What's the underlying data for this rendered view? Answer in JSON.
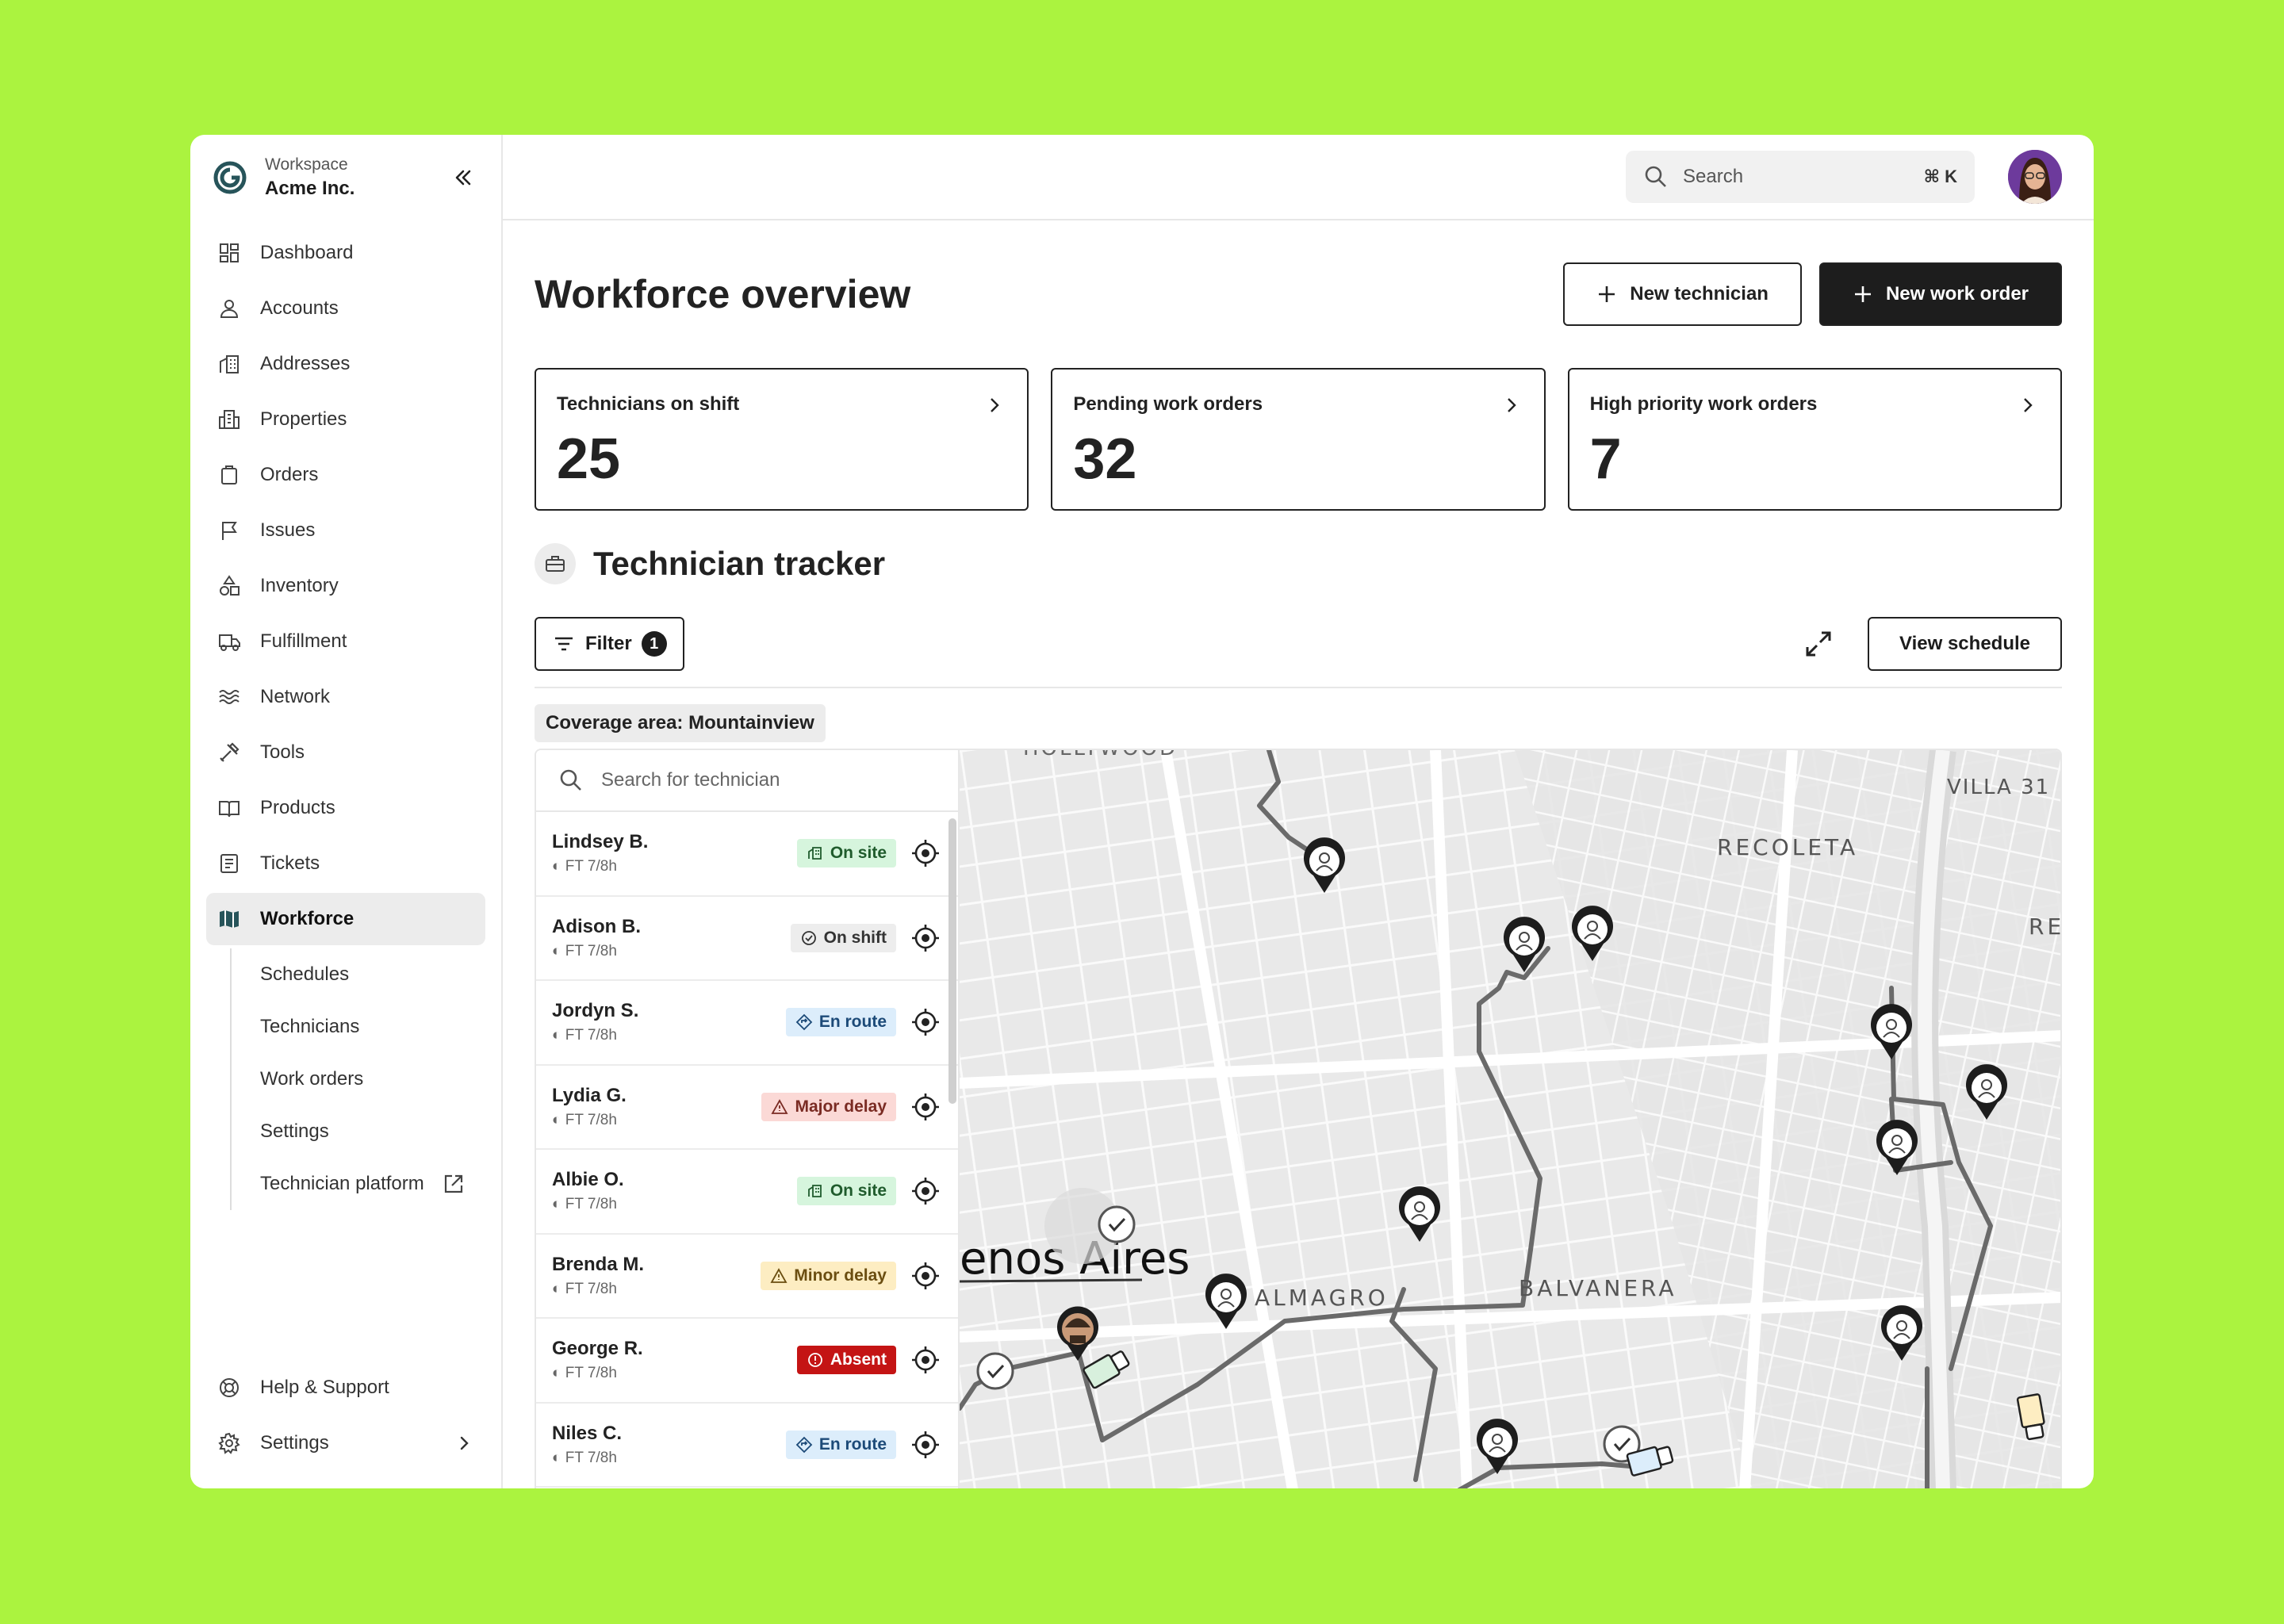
{
  "workspace": {
    "label": "Workspace",
    "name": "Acme Inc."
  },
  "nav": [
    {
      "label": "Dashboard",
      "icon": "dashboard-icon"
    },
    {
      "label": "Accounts",
      "icon": "user-icon"
    },
    {
      "label": "Addresses",
      "icon": "building-icon"
    },
    {
      "label": "Properties",
      "icon": "properties-icon"
    },
    {
      "label": "Orders",
      "icon": "clipboard-icon"
    },
    {
      "label": "Issues",
      "icon": "flag-icon"
    },
    {
      "label": "Inventory",
      "icon": "shapes-icon"
    },
    {
      "label": "Fulfillment",
      "icon": "truck-icon"
    },
    {
      "label": "Network",
      "icon": "waves-icon"
    },
    {
      "label": "Tools",
      "icon": "tools-icon"
    },
    {
      "label": "Products",
      "icon": "book-icon"
    },
    {
      "label": "Tickets",
      "icon": "ticket-icon"
    },
    {
      "label": "Workforce",
      "icon": "map-icon"
    }
  ],
  "subnav": [
    "Schedules",
    "Technicians",
    "Work orders",
    "Settings",
    "Technician platform"
  ],
  "bottom_nav": {
    "help": "Help & Support",
    "settings": "Settings"
  },
  "search": {
    "placeholder": "Search",
    "shortcut": "⌘ K"
  },
  "page": {
    "title": "Workforce overview",
    "new_technician": "New technician",
    "new_work_order": "New work order"
  },
  "stats": [
    {
      "label": "Technicians on shift",
      "value": "25"
    },
    {
      "label": "Pending work orders",
      "value": "32"
    },
    {
      "label": "High priority work orders",
      "value": "7"
    }
  ],
  "tracker": {
    "title": "Technician tracker",
    "filter": "Filter",
    "filter_count": "1",
    "view_schedule": "View schedule",
    "coverage": "Coverage area: Mountainview",
    "search_placeholder": "Search for technician"
  },
  "technicians": [
    {
      "name": "Lindsey B.",
      "meta": "FT  7/8h",
      "status": "On site",
      "kind": "onsite"
    },
    {
      "name": "Adison B.",
      "meta": "FT  7/8h",
      "status": "On shift",
      "kind": "onshift"
    },
    {
      "name": "Jordyn S.",
      "meta": "FT  7/8h",
      "status": "En route",
      "kind": "enroute"
    },
    {
      "name": "Lydia G.",
      "meta": "FT  7/8h",
      "status": "Major delay",
      "kind": "major"
    },
    {
      "name": "Albie O.",
      "meta": "FT  7/8h",
      "status": "On site",
      "kind": "onsite"
    },
    {
      "name": "Brenda M.",
      "meta": "FT  7/8h",
      "status": "Minor delay",
      "kind": "minor"
    },
    {
      "name": "George R.",
      "meta": "FT  7/8h",
      "status": "Absent",
      "kind": "absent"
    },
    {
      "name": "Niles C.",
      "meta": "FT  7/8h",
      "status": "En route",
      "kind": "enroute"
    }
  ],
  "map": {
    "labels": [
      "HOLLYWOOD",
      "VILLA 31",
      "RECOLETA",
      "RE",
      "ALMAGRO",
      "BALVANERA"
    ],
    "city": "enos Aires"
  },
  "colors": {
    "background": "#abf33f",
    "dark": "#1d1d1d",
    "absent": "#c41414"
  }
}
